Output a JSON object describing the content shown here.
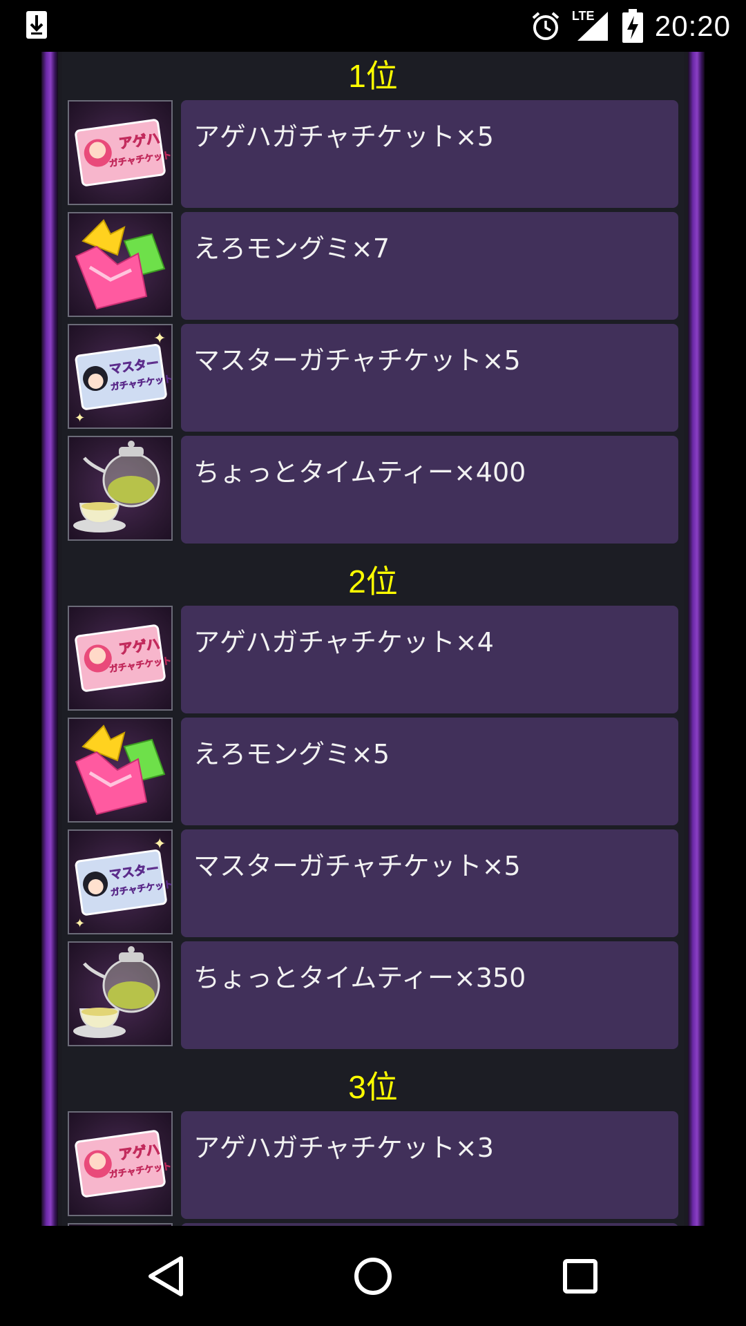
{
  "status_bar": {
    "time": "20:20",
    "network": "LTE",
    "icons": [
      "download-icon",
      "alarm-icon",
      "signal-icon",
      "battery-charging-icon"
    ]
  },
  "ranks": [
    {
      "title": "1位",
      "items": [
        {
          "label": "アゲハガチャチケット×5",
          "icon": "ageha-ticket-icon"
        },
        {
          "label": "えろモングミ×7",
          "icon": "gummy-icon"
        },
        {
          "label": "マスターガチャチケット×5",
          "icon": "master-ticket-icon"
        },
        {
          "label": "ちょっとタイムティー×400",
          "icon": "teapot-icon"
        }
      ]
    },
    {
      "title": "2位",
      "items": [
        {
          "label": "アゲハガチャチケット×4",
          "icon": "ageha-ticket-icon"
        },
        {
          "label": "えろモングミ×5",
          "icon": "gummy-icon"
        },
        {
          "label": "マスターガチャチケット×5",
          "icon": "master-ticket-icon"
        },
        {
          "label": "ちょっとタイムティー×350",
          "icon": "teapot-icon"
        }
      ]
    },
    {
      "title": "3位",
      "items": [
        {
          "label": "アゲハガチャチケット×3",
          "icon": "ageha-ticket-icon"
        }
      ]
    }
  ],
  "ticket_art": {
    "ageha_line1": "アゲハ",
    "ageha_line2": "ガチャチケット",
    "master_line1": "マスター",
    "master_line2": "ガチャチケット"
  },
  "colors": {
    "rank_title": "#ffff00",
    "card_bg": "#41305a",
    "frame_border": "#8a3fc4"
  },
  "nav_bar": {
    "icons": [
      "back-icon",
      "home-icon",
      "recents-icon"
    ]
  }
}
